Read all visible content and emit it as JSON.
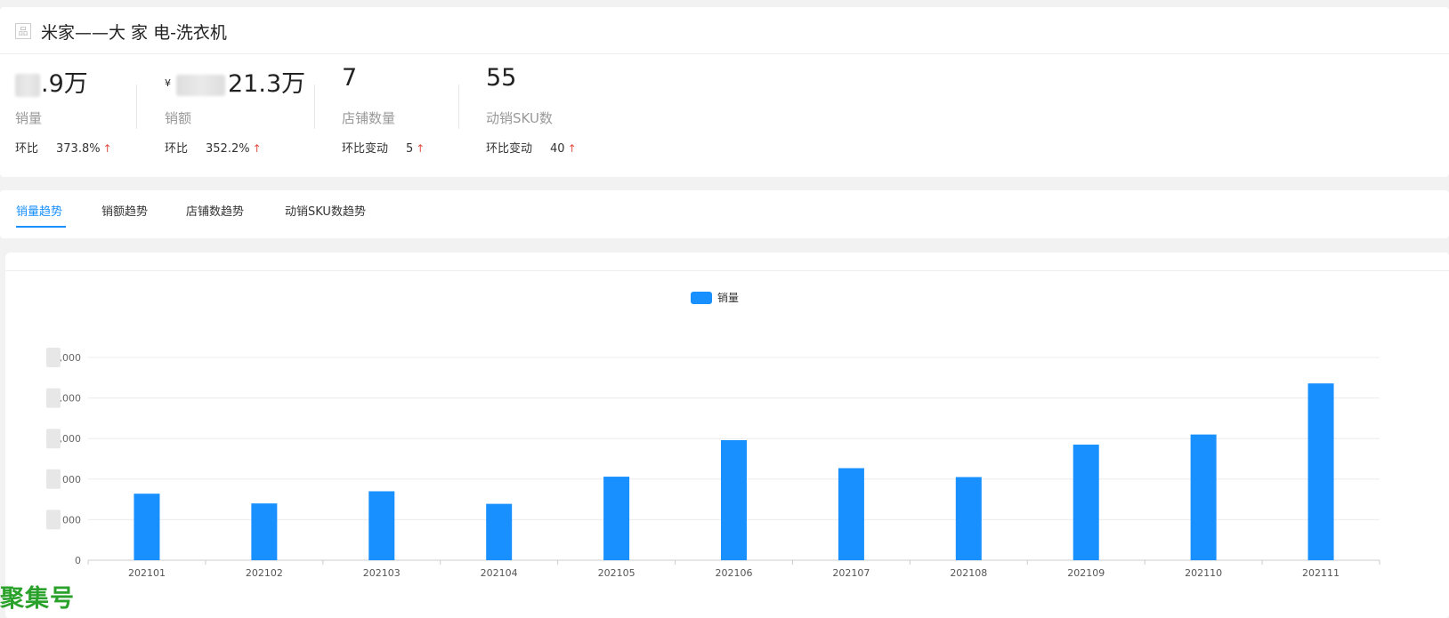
{
  "page": {
    "title_icon": "品",
    "title": "米家——大 家 电-洗衣机"
  },
  "metrics": [
    {
      "id": "sales-volume",
      "value": ".9万",
      "currency": "",
      "label": "销量",
      "cmp_label": "环比",
      "cmp_value": "373.8%",
      "arrow": "↑"
    },
    {
      "id": "sales-amount",
      "value": "21.3万",
      "currency": "¥",
      "label": "销额",
      "cmp_label": "环比",
      "cmp_value": "352.2%",
      "arrow": "↑"
    },
    {
      "id": "store-count",
      "value": "7",
      "currency": "",
      "label": "店铺数量",
      "cmp_label": "环比变动",
      "cmp_value": "5",
      "arrow": "↑"
    },
    {
      "id": "active-sku",
      "value": "55",
      "currency": "",
      "label": "动销SKU数",
      "cmp_label": "环比变动",
      "cmp_value": "40",
      "arrow": "↑"
    }
  ],
  "tabs": [
    {
      "label": "销量趋势",
      "active": true
    },
    {
      "label": "销额趋势",
      "active": false
    },
    {
      "label": "店铺数趋势",
      "active": false
    },
    {
      "label": "动销SKU数趋势",
      "active": false
    }
  ],
  "chart_data": {
    "type": "bar",
    "legend_position": "top-center",
    "grid": true,
    "categories": [
      "202101",
      "202102",
      "202103",
      "202104",
      "202105",
      "202106",
      "202107",
      "202108",
      "202109",
      "202110",
      "202111"
    ],
    "series": [
      {
        "name": "销量",
        "color": "#1890ff",
        "values": [
          1640,
          1400,
          1700,
          1390,
          2060,
          2960,
          2270,
          2050,
          2850,
          3100,
          4360
        ]
      }
    ],
    "ylim": [
      0,
      5000
    ],
    "y_ticks": [
      0,
      1000,
      2000,
      3000,
      4000,
      5000
    ],
    "y_tick_labels": [
      "0",
      "000",
      "000",
      ",000",
      ",000",
      ",000"
    ]
  },
  "watermark": "聚集号",
  "colors": {
    "accent": "#1890ff",
    "up_arrow": "#e54d42"
  }
}
